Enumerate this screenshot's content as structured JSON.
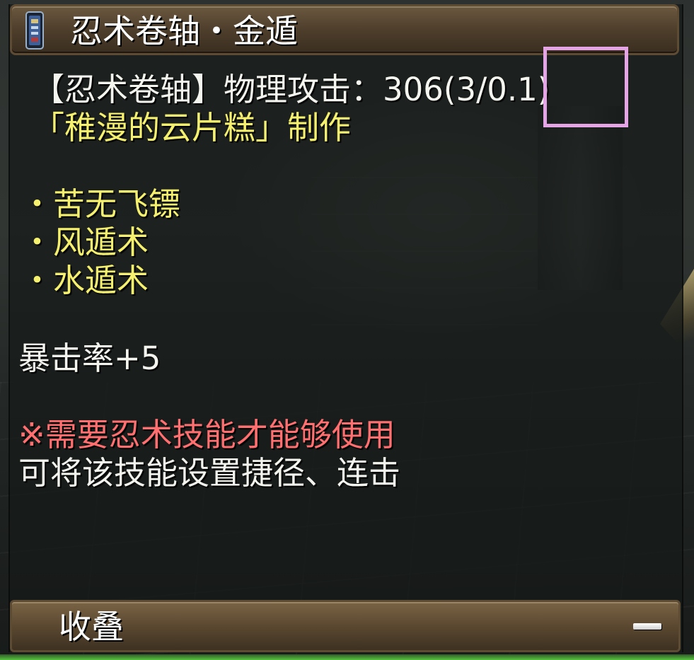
{
  "tooltip": {
    "title": "忍术卷轴・金遁",
    "item_icon": "scroll-icon",
    "attack_line": "【忍术卷轴】物理攻击：306(3/0.1)",
    "maker_line": "「稚漫的云片糕」制作",
    "skills": [
      "・苦无飞镖",
      "・风遁术",
      "・水遁术"
    ],
    "crit_line": "暴击率+5",
    "requirement_line": "※需要忍术技能才能够使用",
    "note_line": "可将该技能设置捷径、连击"
  },
  "footer": {
    "collapse_label": "收叠",
    "collapse_icon": "minus-icon"
  },
  "colors": {
    "white_text": "#f5f5f0",
    "yellow_text": "#f5f06e",
    "red_text": "#ff6f6f",
    "bar_brown": "#5b4830",
    "highlight": "#e5a4e5"
  }
}
